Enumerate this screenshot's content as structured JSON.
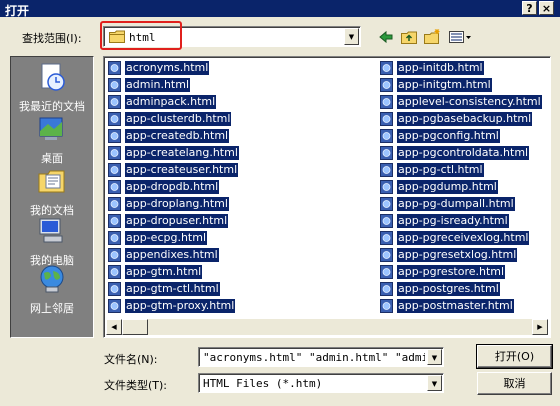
{
  "window": {
    "title": "打开",
    "help_btn": "?",
    "close_btn": "×"
  },
  "lookin": {
    "label": "查找范围(I):",
    "value": "html"
  },
  "places": [
    {
      "label": "我最近的文档",
      "icon": "recent-documents-icon"
    },
    {
      "label": "桌面",
      "icon": "desktop-icon"
    },
    {
      "label": "我的文档",
      "icon": "my-documents-icon"
    },
    {
      "label": "我的电脑",
      "icon": "my-computer-icon"
    },
    {
      "label": "网上邻居",
      "icon": "network-places-icon"
    }
  ],
  "files_col1": [
    "acronyms.html",
    "admin.html",
    "adminpack.html",
    "app-clusterdb.html",
    "app-createdb.html",
    "app-createlang.html",
    "app-createuser.html",
    "app-dropdb.html",
    "app-droplang.html",
    "app-dropuser.html",
    "app-ecpg.html",
    "appendixes.html",
    "app-gtm.html",
    "app-gtm-ctl.html",
    "app-gtm-proxy.html"
  ],
  "files_col2": [
    "app-initdb.html",
    "app-initgtm.html",
    "applevel-consistency.html",
    "app-pgbasebackup.html",
    "app-pgconfig.html",
    "app-pgcontroldata.html",
    "app-pg-ctl.html",
    "app-pgdump.html",
    "app-pg-dumpall.html",
    "app-pg-isready.html",
    "app-pgreceivexlog.html",
    "app-pgresetxlog.html",
    "app-pgrestore.html",
    "app-postgres.html",
    "app-postmaster.html"
  ],
  "filename": {
    "label": "文件名(N):",
    "value": "\"acronyms.html\" \"admin.html\" \"adminpac"
  },
  "filetype": {
    "label": "文件类型(T):",
    "value": "HTML Files (*.htm)"
  },
  "buttons": {
    "open": "打开(O)",
    "cancel": "取消"
  },
  "colors": {
    "selection": "#0a246a",
    "titlebar": "#0a246a",
    "highlight_box": "#e0201c"
  }
}
